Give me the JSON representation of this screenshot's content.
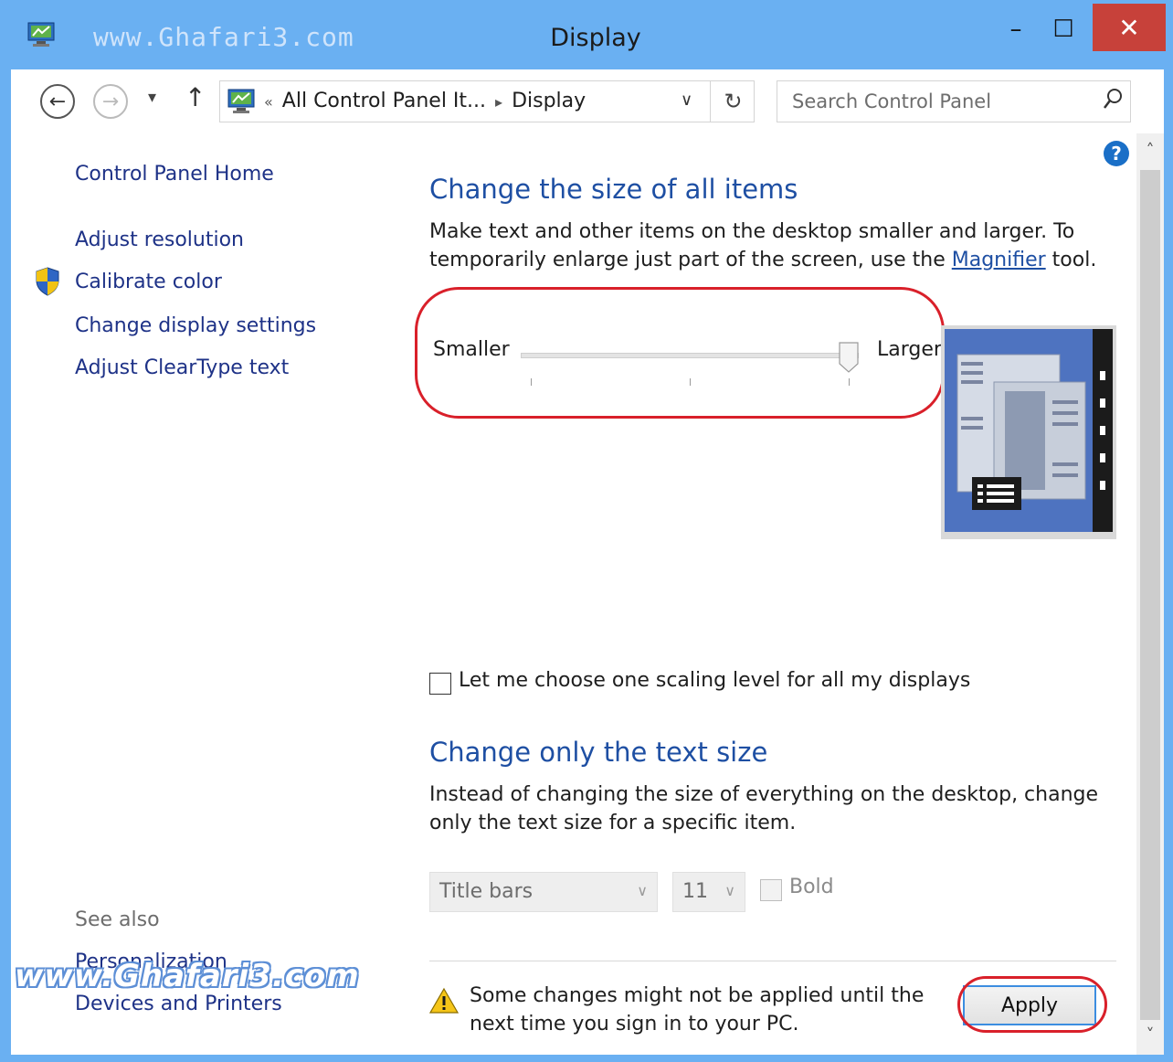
{
  "window": {
    "watermark_top": "www.Ghafari3.com",
    "title": "Display",
    "minimize": "–",
    "maximize": "☐",
    "close": "✕"
  },
  "navbar": {
    "back": "←",
    "forward": "→",
    "recent": "▾",
    "up": "↑",
    "address": {
      "overflow": "«",
      "crumbs": [
        "All Control Panel It...",
        "Display"
      ],
      "separator": "▸",
      "dropdown": "∨",
      "refresh": "↻"
    },
    "search_placeholder": "Search Control Panel"
  },
  "sidebar": {
    "home": "Control Panel Home",
    "links": [
      "Adjust resolution",
      "Calibrate color",
      "Change display settings",
      "Adjust ClearType text"
    ],
    "see_also_label": "See also",
    "see_also": [
      "Personalization",
      "Devices and Printers"
    ],
    "watermark_bottom": "www.Ghafari3.com"
  },
  "help": "?",
  "scroll": {
    "up": "˄",
    "down": "˅"
  },
  "main": {
    "section1_title": "Change the size of all items",
    "section1_text_before": "Make text and other items on the desktop smaller and larger. To temporarily enlarge just part of the screen, use the ",
    "section1_link": "Magnifier",
    "section1_text_after": " tool.",
    "slider": {
      "min_label": "Smaller",
      "max_label": "Larger",
      "level": 1.0,
      "steps": 3
    },
    "checkbox_label": "Let me choose one scaling level for all my displays",
    "checkbox_checked": false,
    "section2_title": "Change only the text size",
    "section2_text": "Instead of changing the size of everything on the desktop, change only the text size for a specific item.",
    "item_select": "Title bars",
    "size_select": "11",
    "bold_label": "Bold",
    "chevron": "∨",
    "warning_text": "Some changes might not be applied until the next time you sign in to your PC.",
    "apply_label": "Apply"
  },
  "colors": {
    "accent": "#6ab0f2",
    "link": "#1e3287",
    "heading": "#1e4fa3",
    "close": "#c7413a",
    "highlight": "#d9202a"
  }
}
